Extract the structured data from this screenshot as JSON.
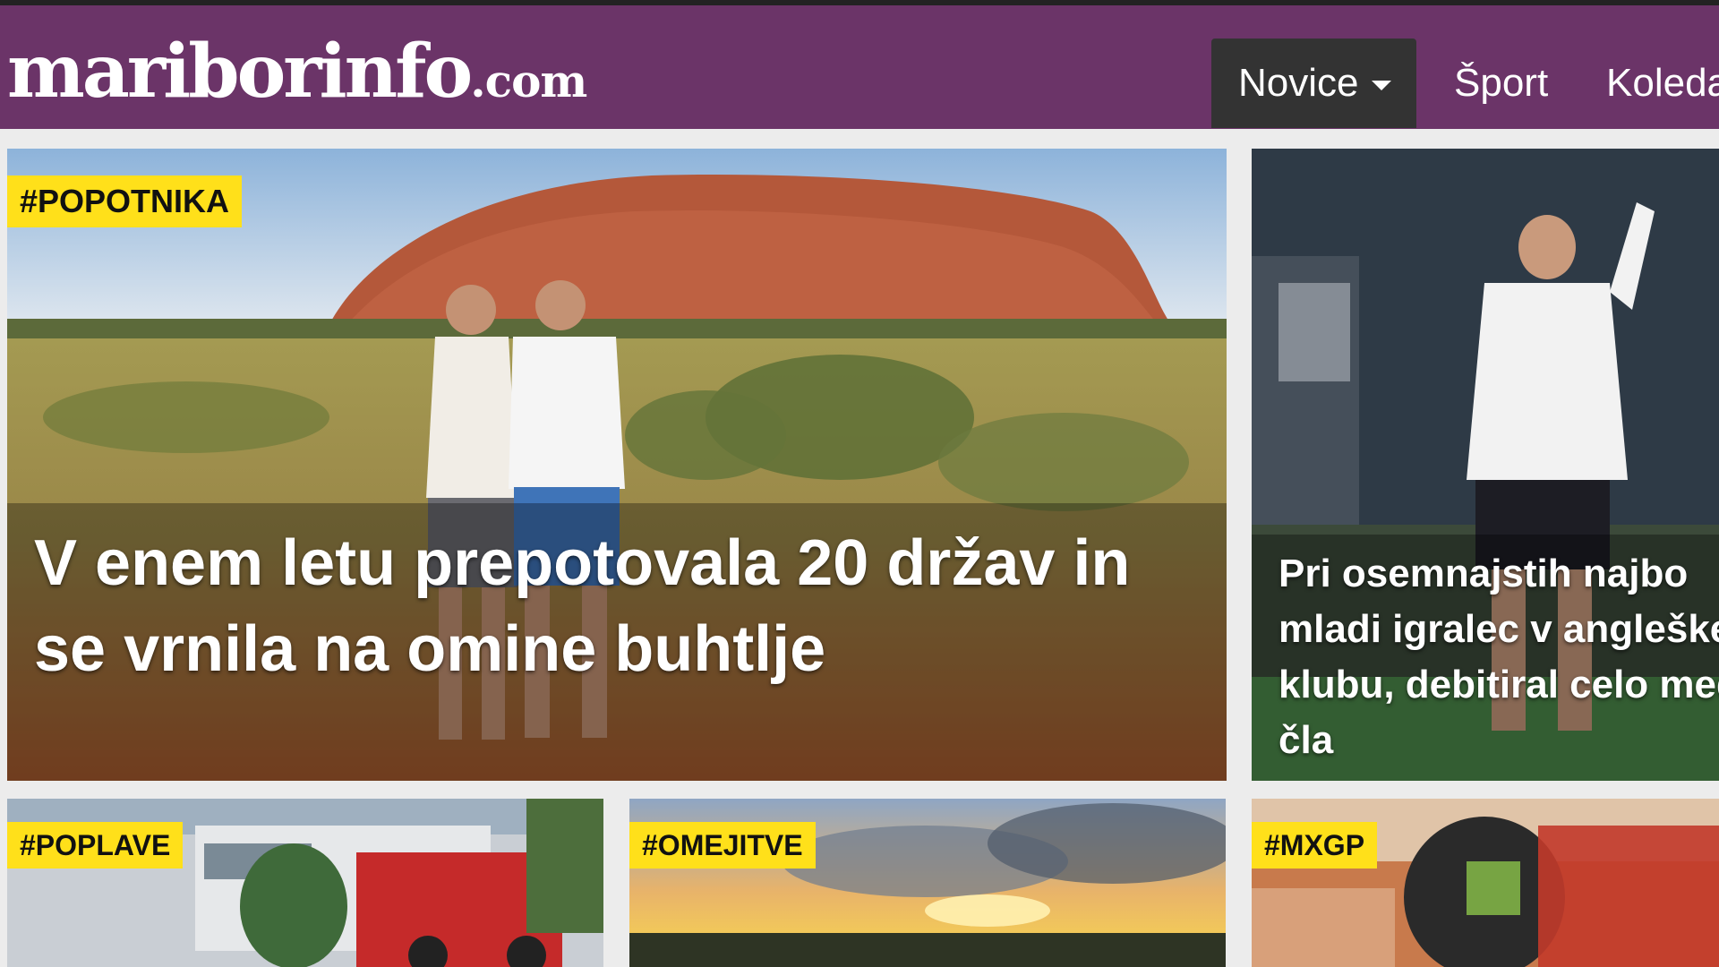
{
  "site": {
    "logo_main": "mariborinfo",
    "logo_tld": ".com"
  },
  "nav": {
    "items": [
      {
        "label": "Novice",
        "active": true
      },
      {
        "label": "Šport"
      },
      {
        "label": "Koleda"
      }
    ]
  },
  "articles": [
    {
      "tag": "#POPOTNIKA",
      "title": "V enem letu prepotovala 20 držav in se vrnila na omine buhtlje"
    },
    {
      "tag": "",
      "title": "Pri osemnajstih najbo mladi igralec v angleškem klubu, debitiral celo med čla"
    },
    {
      "tag": "#POPLAVE",
      "title": ""
    },
    {
      "tag": "#OMEJITVE",
      "title": ""
    },
    {
      "tag": "#MXGP",
      "title": ""
    }
  ],
  "colors": {
    "nav_bg": "#6b3468",
    "tag_bg": "#ffe01a",
    "active_nav_bg": "#333333"
  }
}
